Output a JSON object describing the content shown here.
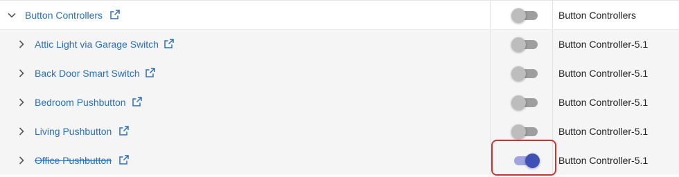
{
  "groups": [
    {
      "name": "Button Controllers",
      "expanded": true,
      "enabled": false,
      "type": "Button Controllers",
      "icons": {
        "toggle": "chevron-down-icon",
        "link": "external-link-icon"
      }
    }
  ],
  "devices": [
    {
      "name": "Attic Light via Garage Switch",
      "enabled": false,
      "type": "Button Controller-5.1",
      "strikethrough": false
    },
    {
      "name": "Back Door Smart Switch",
      "enabled": false,
      "type": "Button Controller-5.1",
      "strikethrough": false
    },
    {
      "name": "Bedroom Pushbutton",
      "enabled": false,
      "type": "Button Controller-5.1",
      "strikethrough": false
    },
    {
      "name": "Living Pushbutton",
      "enabled": false,
      "type": "Button Controller-5.1",
      "strikethrough": false
    },
    {
      "name": "Office Pushbutton",
      "enabled": true,
      "type": "Button Controller-5.1",
      "strikethrough": true
    }
  ],
  "colors": {
    "link": "#2a6ebd",
    "switch_on": "#3f51b5",
    "switch_off": "#bdbdbd",
    "highlight": "#d32f2f",
    "row_alt": "#f5f5f5"
  }
}
